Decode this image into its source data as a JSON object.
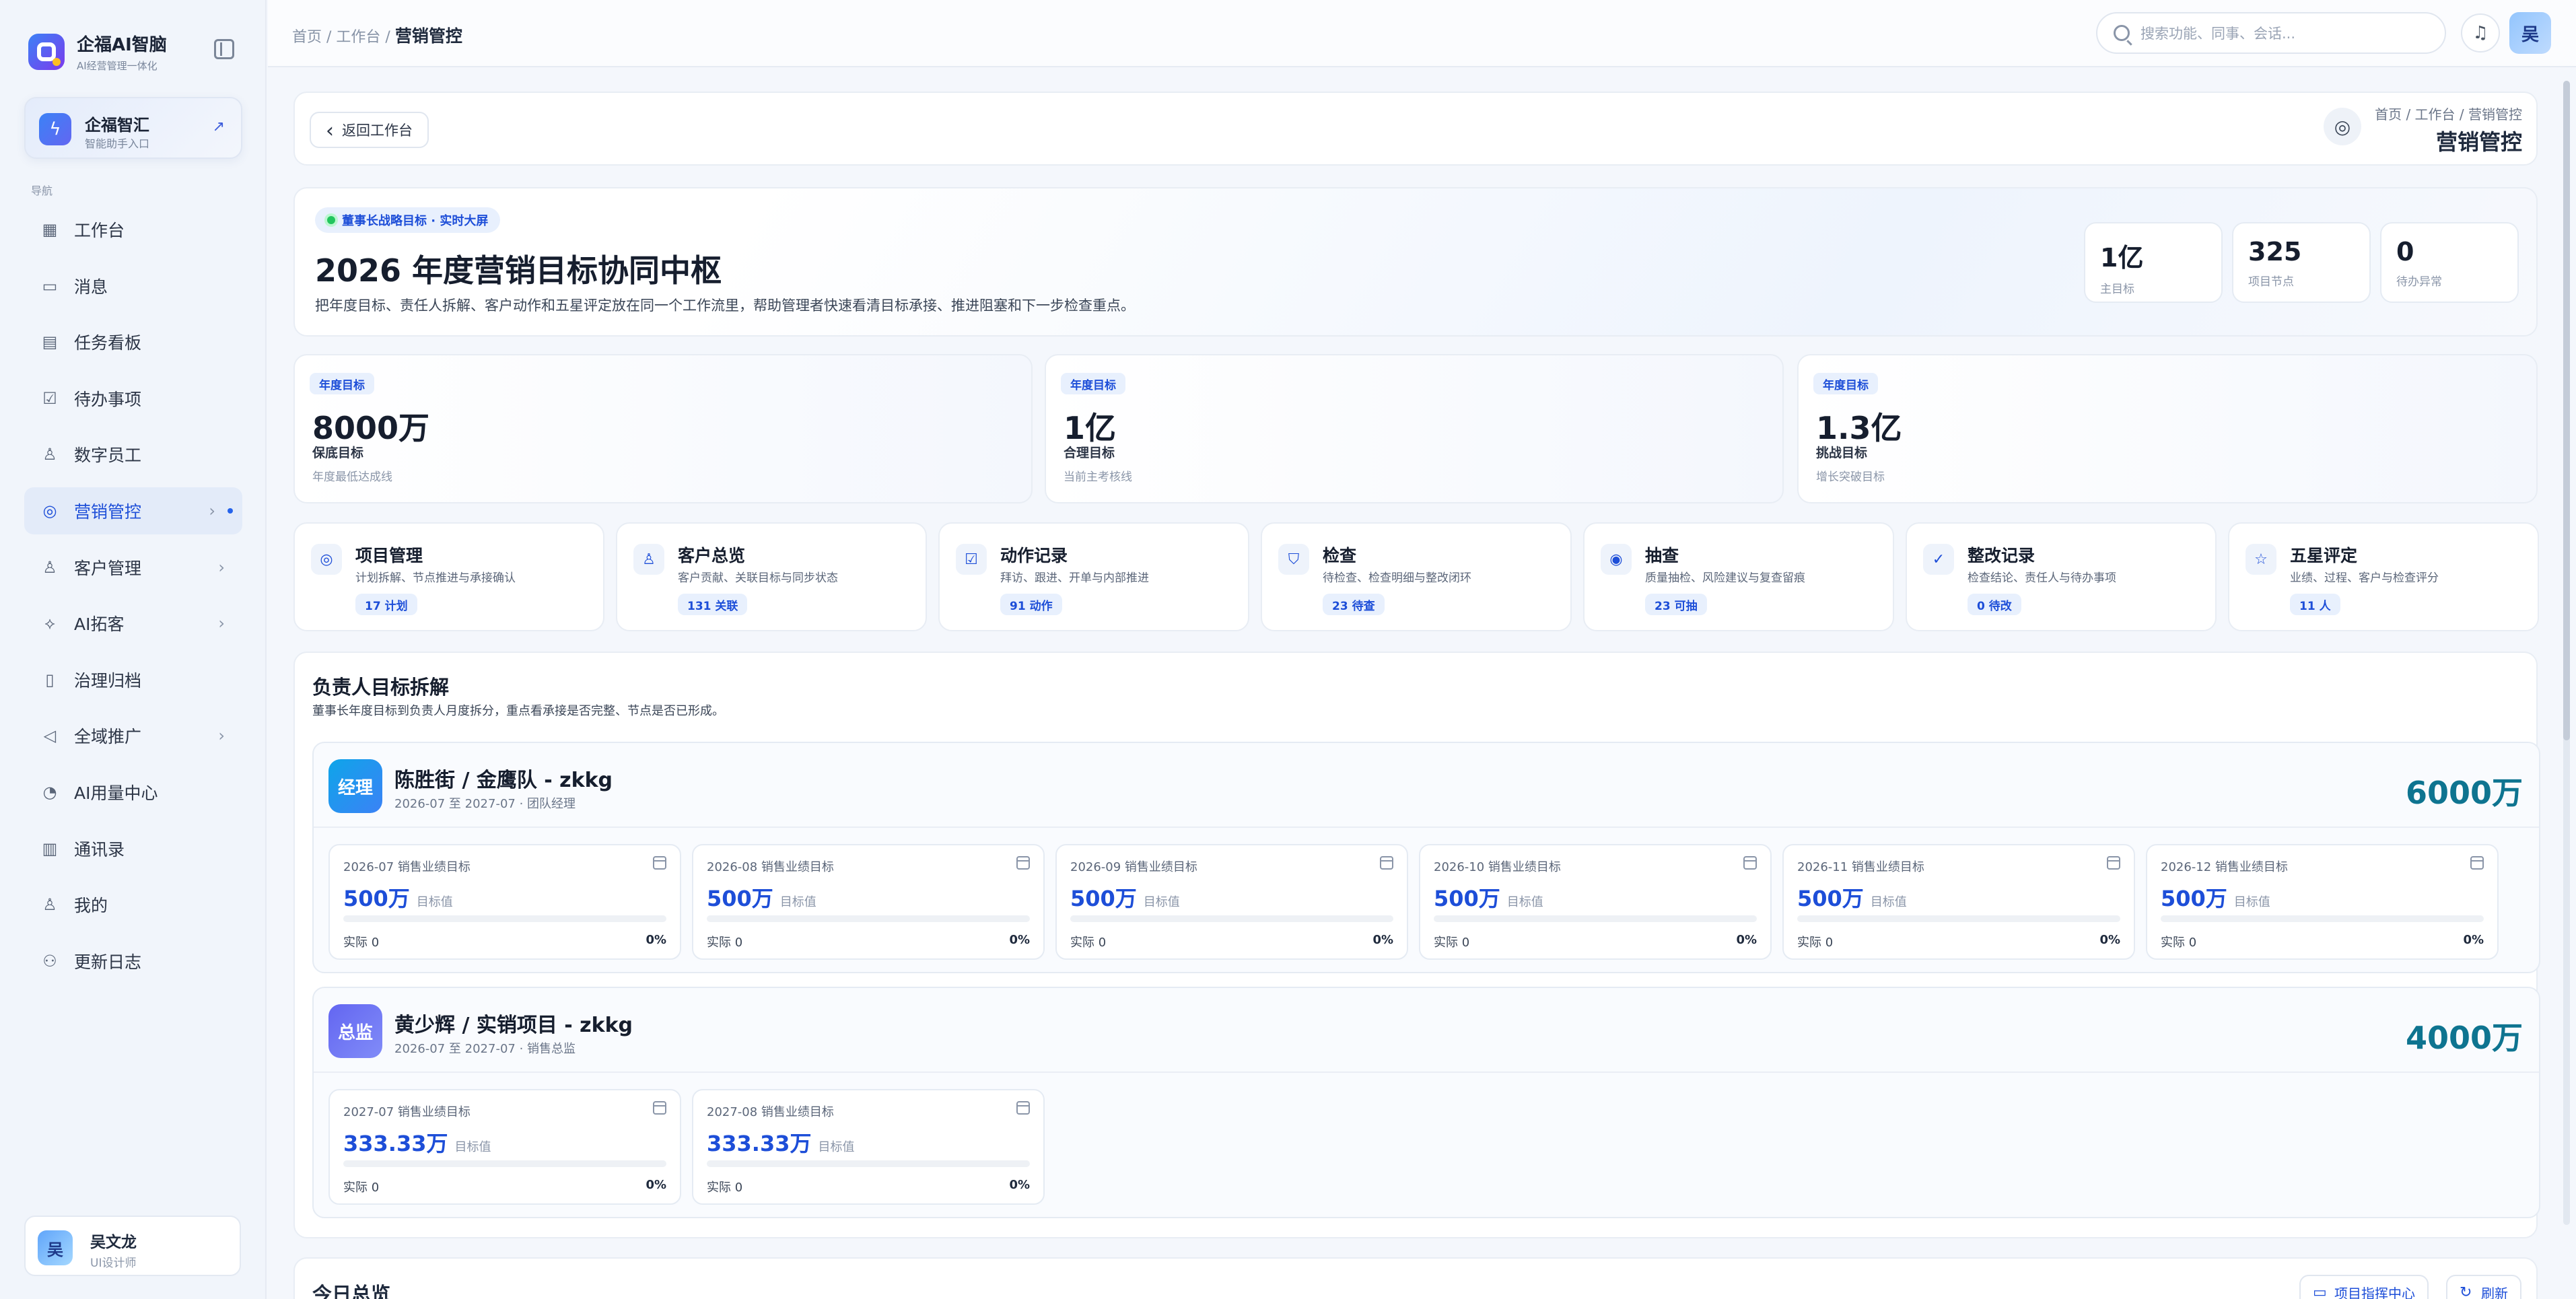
{
  "sidebar": {
    "brand_name": "企福AI智脑",
    "brand_sub": "AI经营管理一体化",
    "assistant_title": "企福智汇",
    "assistant_sub": "智能助手入口",
    "nav_caption": "导航",
    "items": [
      {
        "label": "工作台",
        "icon": "dashboard-icon",
        "glyph": "▦"
      },
      {
        "label": "消息",
        "icon": "message-icon",
        "glyph": "▭"
      },
      {
        "label": "任务看板",
        "icon": "kanban-icon",
        "glyph": "▤"
      },
      {
        "label": "待办事项",
        "icon": "todo-icon",
        "glyph": "☑"
      },
      {
        "label": "数字员工",
        "icon": "user-icon",
        "glyph": "♙"
      },
      {
        "label": "营销管控",
        "icon": "target-icon",
        "glyph": "◎"
      },
      {
        "label": "客户管理",
        "icon": "user-icon",
        "glyph": "♙"
      },
      {
        "label": "AI拓客",
        "icon": "ai-icon",
        "glyph": "⟡"
      },
      {
        "label": "治理归档",
        "icon": "archive-icon",
        "glyph": "▯"
      },
      {
        "label": "全域推广",
        "icon": "megaphone-icon",
        "glyph": "◁"
      },
      {
        "label": "AI用量中心",
        "icon": "gauge-icon",
        "glyph": "◔"
      },
      {
        "label": "通讯录",
        "icon": "book-icon",
        "glyph": "▥"
      },
      {
        "label": "我的",
        "icon": "profile-icon",
        "glyph": "♙"
      },
      {
        "label": "更新日志",
        "icon": "log-icon",
        "glyph": "⚇"
      }
    ],
    "user_name": "吴文龙",
    "user_role": "UI设计师",
    "user_initial": "吴"
  },
  "topbar": {
    "crumb_home": "首页",
    "crumb_workbench": "工作台",
    "crumb_current": "营销管控",
    "search_placeholder": "搜索功能、同事、会话...",
    "avatar_initial": "吴"
  },
  "page_header": {
    "back_label": "返回工作台",
    "crumb": "首页 / 工作台 / 营销管控",
    "title": "营销管控"
  },
  "hero": {
    "badge": "董事长战略目标 · 实时大屏",
    "title": "2026 年度营销目标协同中枢",
    "desc": "把年度目标、责任人拆解、客户动作和五星评定放在同一个工作流里，帮助管理者快速看清目标承接、推进阻塞和下一步检查重点。",
    "stats": [
      {
        "value": "1亿",
        "label": "主目标"
      },
      {
        "value": "325",
        "label": "项目节点"
      },
      {
        "value": "0",
        "label": "待办异常"
      }
    ]
  },
  "goals": [
    {
      "tag": "年度目标",
      "value": "8000万",
      "name": "保底目标",
      "sub": "年度最低达成线"
    },
    {
      "tag": "年度目标",
      "value": "1亿",
      "name": "合理目标",
      "sub": "当前主考核线"
    },
    {
      "tag": "年度目标",
      "value": "1.3亿",
      "name": "挑战目标",
      "sub": "增长突破目标"
    }
  ],
  "modules": [
    {
      "title": "项目管理",
      "sub": "计划拆解、节点推进与承接确认",
      "badge": "17 计划",
      "glyph": "◎",
      "icon": "target-icon"
    },
    {
      "title": "客户总览",
      "sub": "客户贡献、关联目标与同步状态",
      "badge": "131 关联",
      "glyph": "♙",
      "icon": "users-icon"
    },
    {
      "title": "动作记录",
      "sub": "拜访、跟进、开单与内部推进",
      "badge": "91 动作",
      "glyph": "☑",
      "icon": "clipboard-icon"
    },
    {
      "title": "检查",
      "sub": "待检查、检查明细与整改闭环",
      "badge": "23 待查",
      "glyph": "⛉",
      "icon": "shield-icon"
    },
    {
      "title": "抽查",
      "sub": "质量抽检、风险建议与复查留痕",
      "badge": "23 可抽",
      "glyph": "◉",
      "icon": "eye-icon"
    },
    {
      "title": "整改记录",
      "sub": "检查结论、责任人与待办事项",
      "badge": "0 待改",
      "glyph": "✓",
      "icon": "check-circle-icon"
    },
    {
      "title": "五星评定",
      "sub": "业绩、过程、客户与检查评分",
      "badge": "11 人",
      "glyph": "☆",
      "icon": "star-icon"
    }
  ],
  "breakdown": {
    "title": "负责人目标拆解",
    "sub": "董事长年度目标到负责人月度拆分，重点看承接是否完整、节点是否已形成。",
    "owners": [
      {
        "role": "经理",
        "name": "陈胜街 / 金鹰队 - zkkg",
        "period": "2026-07 至 2027-07 · 团队经理",
        "total": "6000万",
        "months": [
          {
            "label": "2026-07 销售业绩目标",
            "value": "500万",
            "value_label": "目标值",
            "actual": "实际 0",
            "pct": "0%",
            "progress": 0
          },
          {
            "label": "2026-08 销售业绩目标",
            "value": "500万",
            "value_label": "目标值",
            "actual": "实际 0",
            "pct": "0%",
            "progress": 0
          },
          {
            "label": "2026-09 销售业绩目标",
            "value": "500万",
            "value_label": "目标值",
            "actual": "实际 0",
            "pct": "0%",
            "progress": 0
          },
          {
            "label": "2026-10 销售业绩目标",
            "value": "500万",
            "value_label": "目标值",
            "actual": "实际 0",
            "pct": "0%",
            "progress": 0
          },
          {
            "label": "2026-11 销售业绩目标",
            "value": "500万",
            "value_label": "目标值",
            "actual": "实际 0",
            "pct": "0%",
            "progress": 0
          },
          {
            "label": "2026-12 销售业绩目标",
            "value": "500万",
            "value_label": "目标值",
            "actual": "实际 0",
            "pct": "0%",
            "progress": 0
          }
        ]
      },
      {
        "role": "总监",
        "name": "黄少辉 / 实销项目 - zkkg",
        "period": "2026-07 至 2027-07 · 销售总监",
        "total": "4000万",
        "months": [
          {
            "label": "2027-07 销售业绩目标",
            "value": "333.33万",
            "value_label": "目标值",
            "actual": "实际 0",
            "pct": "0%",
            "progress": 0
          },
          {
            "label": "2027-08 销售业绩目标",
            "value": "333.33万",
            "value_label": "目标值",
            "actual": "实际 0",
            "pct": "0%",
            "progress": 0
          }
        ]
      }
    ]
  },
  "today": {
    "title": "今日总览",
    "btn_center": "项目指挥中心",
    "btn_refresh": "刷新"
  },
  "colors": {
    "accent": "#1d4ed8",
    "owner_total": "#0e7490",
    "manager_avatar": "#0ea5e9",
    "director_avatar": "#6366f1"
  }
}
